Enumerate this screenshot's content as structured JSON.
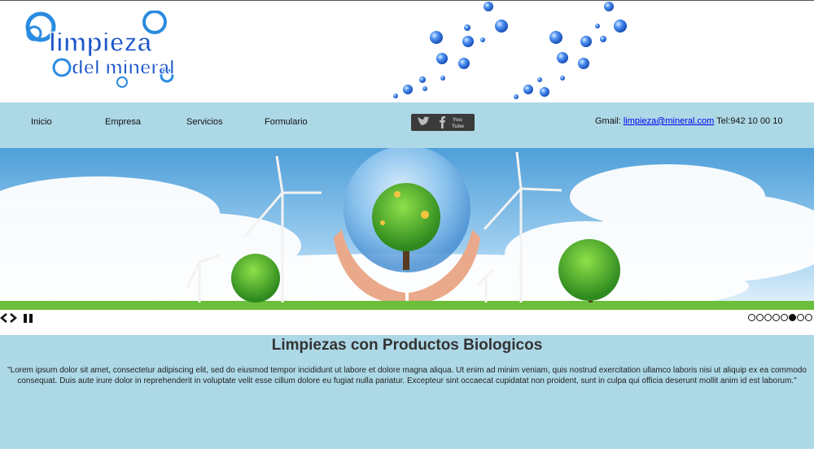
{
  "header": {
    "logo_line1": "limpieza",
    "logo_line2": "del mineral"
  },
  "nav": {
    "items": [
      "Inicio",
      "Empresa",
      "Servicios",
      "Formulario"
    ]
  },
  "social": {
    "youtube_line1": "You",
    "youtube_line2": "Tube"
  },
  "contact": {
    "gmail_label": "Gmail:",
    "email": "limpieza@mineral.com",
    "phone": "Tel:942 10 00 10"
  },
  "slider": {
    "prev_icon": "chevron-left-icon",
    "next_icon": "chevron-right-icon",
    "pause_icon": "pause-icon",
    "slide_count": 8,
    "active_slide": 6
  },
  "content": {
    "title": "Limpiezas con Productos Biologicos",
    "body": "\"Lorem ipsum dolor sit amet, consectetur adipiscing elit, sed do eiusmod tempor incididunt ut labore et dolore magna aliqua. Ut enim ad minim veniam, quis nostrud exercitation ullamco laboris nisi ut aliquip ex ea commodo consequat. Duis aute irure dolor in reprehenderit in voluptate velit esse cillum dolore eu fugiat nulla pariatur. Excepteur sint occaecat cupidatat non proident, sunt in culpa qui officia deserunt mollit anim id est laborum.\""
  },
  "colors": {
    "nav_background": "#add8e6",
    "logo_blue": "#1e6fd9",
    "bubble_blue": "#3b7fe0"
  }
}
